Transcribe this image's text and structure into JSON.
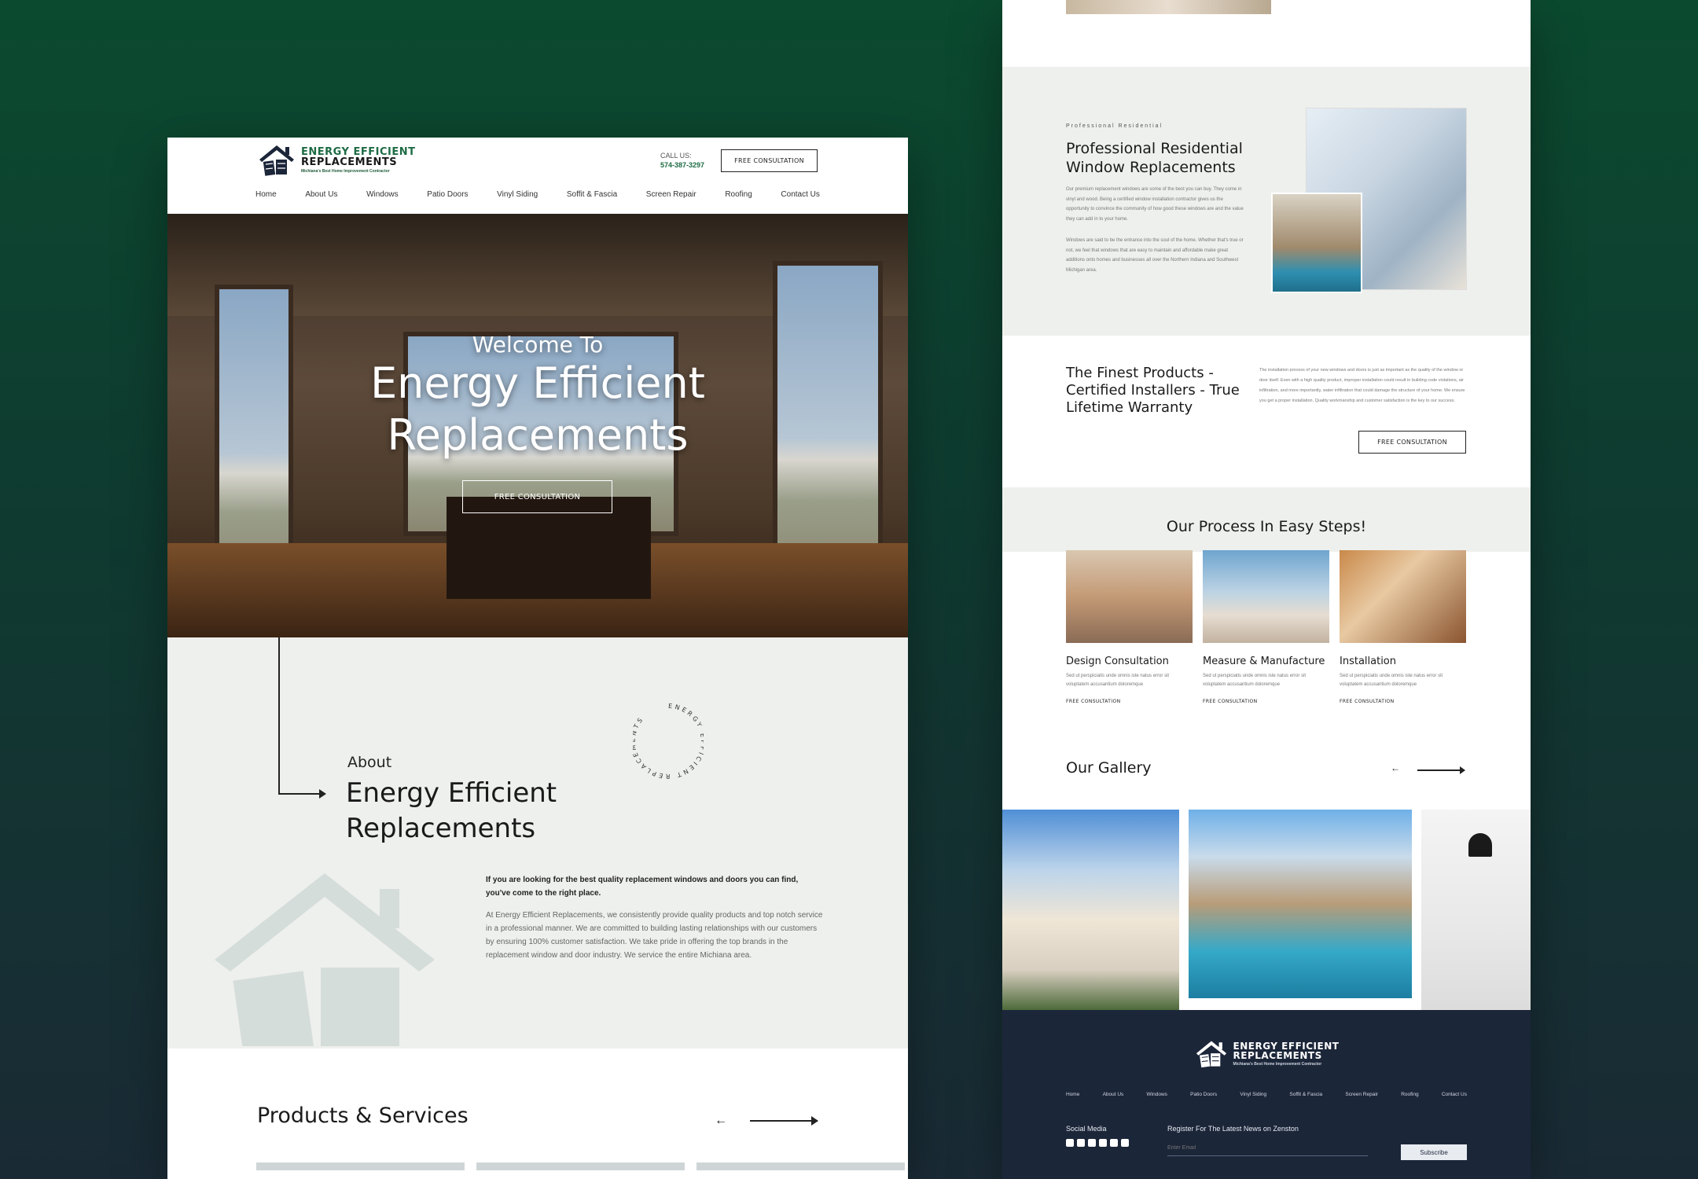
{
  "left": {
    "logo": {
      "line1": "ENERGY EFFICIENT",
      "line2": "REPLACEMENTS",
      "tagline": "Michiana's Best Home Improvement Contractor"
    },
    "call": {
      "label": "CALL US:",
      "phone": "574-387-3297"
    },
    "header_button": "FREE CONSULTATION",
    "nav": [
      "Home",
      "About Us",
      "Windows",
      "Patio Doors",
      "Vinyl Siding",
      "Soffit & Fascia",
      "Screen Repair",
      "Roofing",
      "Contact Us"
    ],
    "hero": {
      "pre": "Welcome To",
      "line1": "Energy Efficient",
      "line2": "Replacements",
      "button": "FREE CONSULTATION"
    },
    "about": {
      "pre": "About",
      "heading": "Energy Efficient Replacements",
      "badge_text": "ENERGY EFFICIENT REPLACEMENTS",
      "p1": "If you are looking for the best quality replacement windows and doors you can find, you've come to the right place.",
      "p2": "At Energy Efficient Replacements, we consistently provide quality products and top notch service in a professional manner. We are committed to building lasting relationships with our customers by ensuring 100% customer satisfaction. We take pride in offering the top brands in the replacement window and door industry. We service the entire Michiana area."
    },
    "products": {
      "heading": "Products & Services",
      "prev": "←"
    }
  },
  "right": {
    "residential": {
      "eyebrow": "Professional Residential",
      "heading": "Professional Residential Window Replacements",
      "p1": "Our premium replacement windows are some of the best you can buy. They come in vinyl and wood. Being a certified window installation contractor gives us the opportunity to convince the community of how good these windows are and the value they can add in to your home.",
      "p2": "Windows are said to be the entrance into the soul of the home. Whether that's true or not, we feel that windows that are easy to maintain and affordable make great additions onto homes and businesses all over the Northern Indiana and Southwest Michigan area."
    },
    "finest": {
      "heading": "The Finest Products - Certified Installers - True Lifetime Warranty",
      "body": "The installation process of your new windows and doors is just as important as the quality of the window or door itself. Even with a high quality product, improper installation could result in building code violations, air infiltration, and more importantly, water infiltration that could damage the structure of your home. We ensure you get a proper installation. Quality workmanship and customer satisfaction is the key to our success.",
      "button": "FREE CONSULTATION"
    },
    "process": {
      "heading": "Our Process In Easy Steps!",
      "steps": [
        {
          "title": "Design Consultation",
          "desc": "Sed ut perspiciatis unde omnis iste natus error sit voluptatem accusantium doloremque",
          "link": "FREE CONSULTATION"
        },
        {
          "title": "Measure & Manufacture",
          "desc": "Sed ut perspiciatis unde omnis iste natus error sit voluptatem accusantium doloremque",
          "link": "FREE CONSULTATION"
        },
        {
          "title": "Installation",
          "desc": "Sed ut perspiciatis unde omnis iste natus error sit voluptatem accusantium doloremque",
          "link": "FREE CONSULTATION"
        }
      ]
    },
    "gallery": {
      "heading": "Our Gallery",
      "prev": "←"
    },
    "footer": {
      "logo1": "ENERGY EFFICIENT",
      "logo2": "REPLACEMENTS",
      "tagline": "Michiana's Best Home Improvement Contractor",
      "nav": [
        "Home",
        "About Us",
        "Windows",
        "Patio Doors",
        "Vinyl Siding",
        "Soffit & Fascia",
        "Screen Repair",
        "Roofing",
        "Contact Us"
      ],
      "social_label": "Social Media",
      "social_icons": [
        "facebook-icon",
        "twitter-icon",
        "youtube-icon",
        "instagram-icon",
        "pinterest-icon",
        "linkedin-icon"
      ],
      "register_label": "Register For The Latest News on Zenston",
      "email_placeholder": "Enter Email",
      "subscribe": "Subscribe"
    }
  }
}
